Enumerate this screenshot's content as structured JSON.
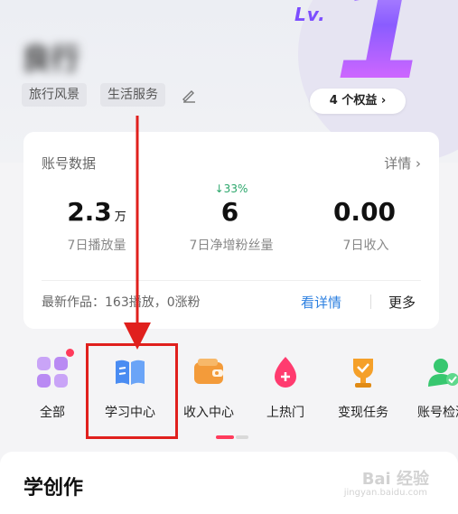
{
  "header": {
    "level_label": "Lv.",
    "level_number": "1",
    "username": "良行",
    "tags": [
      "旅行风景",
      "生活服务"
    ],
    "rights_button": "4 个权益 ›"
  },
  "account_card": {
    "title": "账号数据",
    "detail_link": "详情 ›",
    "stats": [
      {
        "badge": "",
        "value": "2.3",
        "unit": "万",
        "label": "7日播放量"
      },
      {
        "badge": "↓33%",
        "value": "6",
        "unit": "",
        "label": "7日净增粉丝量"
      },
      {
        "badge": "",
        "value": "0.00",
        "unit": "",
        "label": "7日收入"
      }
    ],
    "latest_work": "最新作品：163播放，0涨粉",
    "view_detail": "看详情",
    "more": "更多"
  },
  "shortcuts": [
    {
      "label": "全部",
      "icon": "grid-icon",
      "color": "#b98af3"
    },
    {
      "label": "学习中心",
      "icon": "book-icon",
      "color": "#4a8cf2"
    },
    {
      "label": "收入中心",
      "icon": "wallet-icon",
      "color": "#f39b3a"
    },
    {
      "label": "上热门",
      "icon": "flame-drop-icon",
      "color": "#ff3b6f"
    },
    {
      "label": "变现任务",
      "icon": "trophy-icon",
      "color": "#f5a029"
    },
    {
      "label": "账号检测",
      "icon": "account-check-icon",
      "color": "#37c76f"
    }
  ],
  "section": {
    "title": "学创作"
  },
  "watermark": {
    "text": "Bai 经验",
    "sub": "jingyan.baidu.com"
  },
  "colors": {
    "accent_red": "#ff3b5c",
    "link_blue": "#2b7fe0",
    "growth_green": "#2aa66a",
    "annotation_red": "#e0201d"
  }
}
